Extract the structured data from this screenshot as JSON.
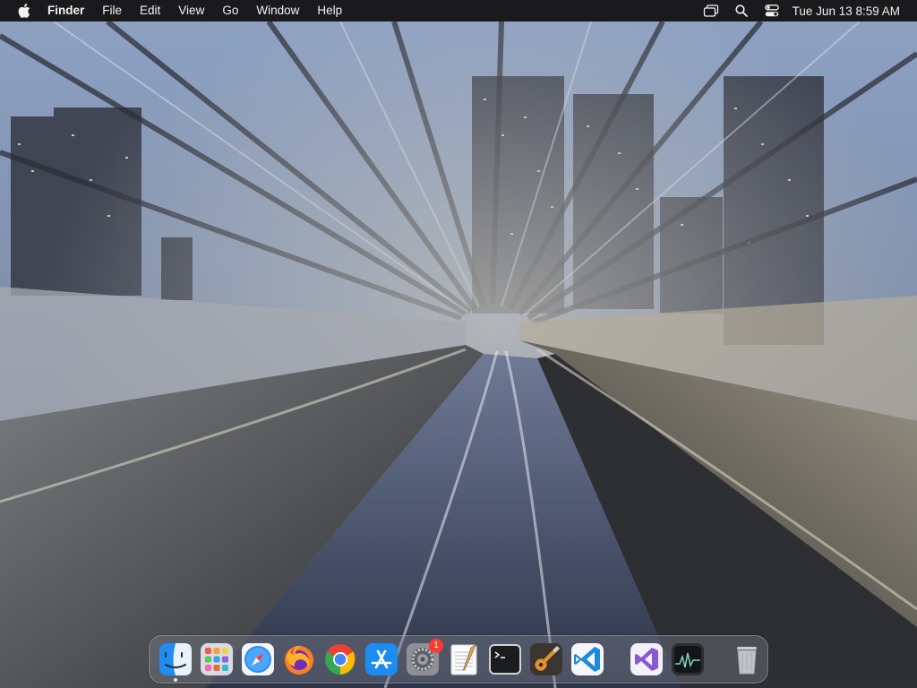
{
  "menubar": {
    "app_name": "Finder",
    "items": [
      "File",
      "Edit",
      "View",
      "Go",
      "Window",
      "Help"
    ],
    "clock": "Tue Jun 13  8:59 AM",
    "status_icons": [
      "window-switcher-icon",
      "search-icon",
      "control-center-icon"
    ]
  },
  "desktop": {
    "wallpaper": "motion-blurred train tunnel with city skyline"
  },
  "dock": {
    "apps": [
      {
        "name": "Finder",
        "icon": "finder-icon",
        "running": true
      },
      {
        "name": "Launchpad",
        "icon": "launchpad-icon"
      },
      {
        "name": "Safari",
        "icon": "safari-icon"
      },
      {
        "name": "Firefox",
        "icon": "firefox-icon"
      },
      {
        "name": "Google Chrome",
        "icon": "chrome-icon"
      },
      {
        "name": "App Store",
        "icon": "app-store-icon"
      },
      {
        "name": "System Preferences",
        "icon": "system-preferences-icon",
        "badge": "1"
      },
      {
        "name": "TextEdit",
        "icon": "textedit-icon"
      },
      {
        "name": "Terminal",
        "icon": "terminal-icon"
      },
      {
        "name": "GarageBand",
        "icon": "garageband-icon"
      },
      {
        "name": "Visual Studio Code",
        "icon": "vscode-icon"
      }
    ],
    "recent": [
      {
        "name": "Visual Studio",
        "icon": "visual-studio-icon"
      },
      {
        "name": "Activity Monitor",
        "icon": "activity-monitor-icon"
      }
    ],
    "trash": {
      "name": "Trash",
      "icon": "trash-icon"
    }
  }
}
